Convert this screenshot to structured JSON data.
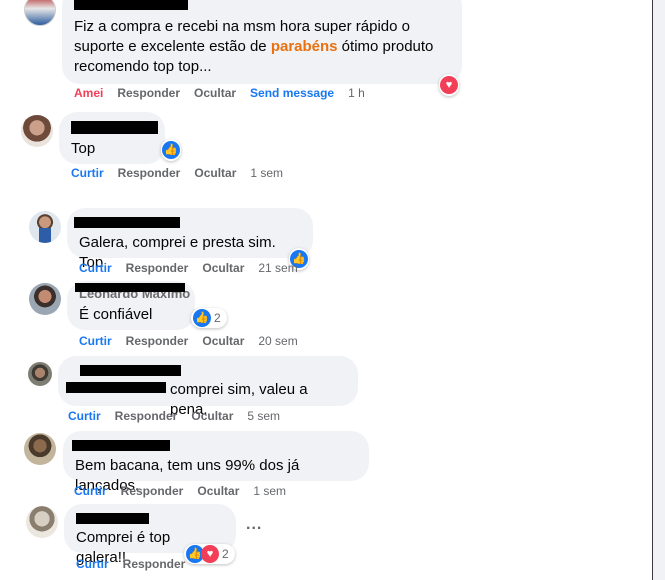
{
  "comments": [
    {
      "text_lines": [
        "Fiz a compra e recebi na msm hora super rápido o",
        "suporte e excelente estão de ",
        "recomendo top top..."
      ],
      "highlight": "parabéns",
      "after_highlight": " ótimo produto",
      "actions": {
        "react": "Amei",
        "reply": "Responder",
        "hide": "Ocultar",
        "send": "Send message",
        "time": "1 h"
      }
    },
    {
      "text": "Top",
      "actions": {
        "react": "Curtir",
        "reply": "Responder",
        "hide": "Ocultar",
        "time": "1 sem"
      }
    },
    {
      "text": "Galera, comprei e presta sim. Top.",
      "actions": {
        "react": "Curtir",
        "reply": "Responder",
        "hide": "Ocultar",
        "time": "21 sem"
      }
    },
    {
      "name_partial": "Leonardo Maximo",
      "text": "É confiável",
      "reaction_count": "2",
      "actions": {
        "react": "Curtir",
        "reply": "Responder",
        "hide": "Ocultar",
        "time": "20 sem"
      }
    },
    {
      "text": "comprei sim, valeu a pena.",
      "actions": {
        "react": "Curtir",
        "reply": "Responder",
        "hide": "Ocultar",
        "time": "5 sem"
      }
    },
    {
      "text": "Bem bacana, tem uns 99% dos já lançados.",
      "actions": {
        "react": "Curtir",
        "reply": "Responder",
        "hide": "Ocultar",
        "time": "1 sem"
      }
    },
    {
      "text": "Comprei é top galera!!",
      "reaction_count": "2",
      "more": "...",
      "actions": {
        "react": "Curtir",
        "reply": "Responder"
      }
    }
  ],
  "icons": {
    "like": "thumbs-up-icon",
    "love": "heart-icon"
  },
  "colors": {
    "link": "#1877f2",
    "love": "#f33e58",
    "highlight": "#e9710f"
  }
}
